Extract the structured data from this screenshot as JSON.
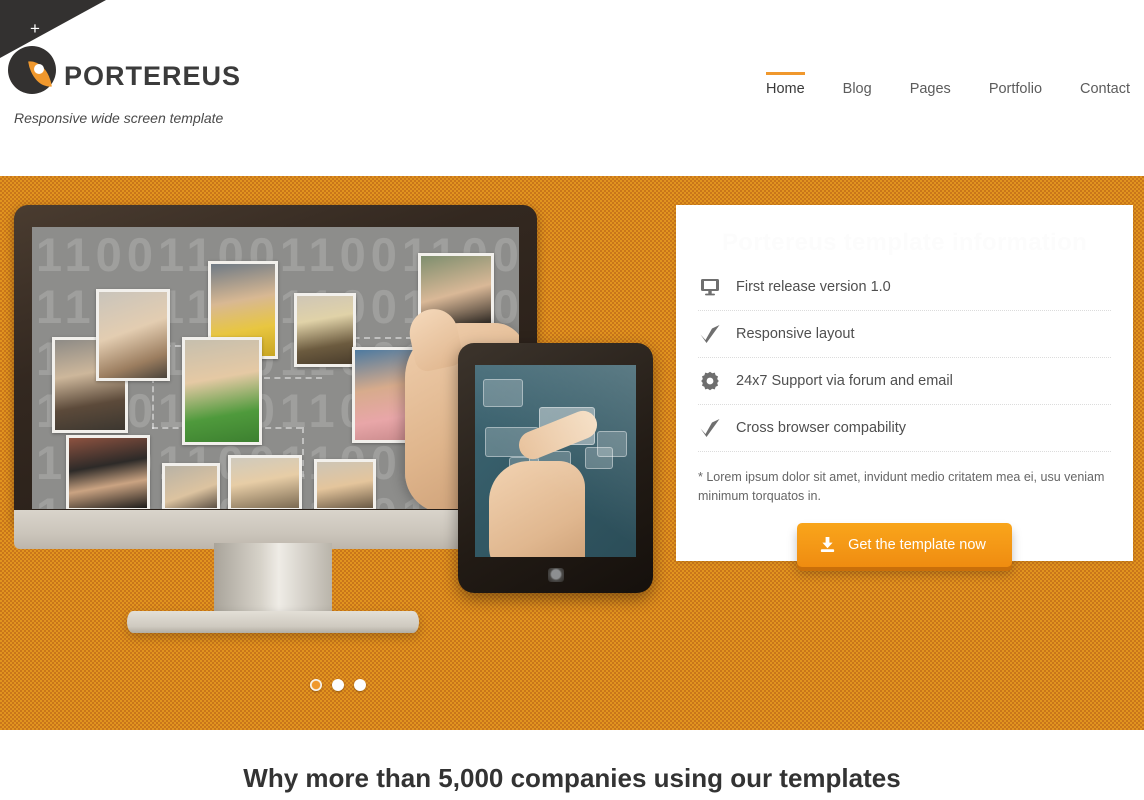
{
  "header": {
    "corner_plus_label": "+",
    "brand": "PORTEREUS",
    "tagline": "Responsive wide screen template",
    "nav": [
      {
        "label": "Home",
        "active": true
      },
      {
        "label": "Blog",
        "active": false
      },
      {
        "label": "Pages",
        "active": false
      },
      {
        "label": "Portfolio",
        "active": false
      },
      {
        "label": "Contact",
        "active": false
      }
    ]
  },
  "hero": {
    "panel": {
      "title": "Portereus template information",
      "features": [
        {
          "icon": "monitor-icon",
          "label": "First release version 1.0"
        },
        {
          "icon": "check-icon",
          "label": "Responsive layout"
        },
        {
          "icon": "gear-icon",
          "label": "24x7 Support via forum and email"
        },
        {
          "icon": "check-icon",
          "label": "Cross browser compability"
        }
      ],
      "note": "* Lorem ipsum dolor sit amet, invidunt medio critatem mea ei, usu veniam minimum torquatos in.",
      "cta_label": "Get the template now",
      "cta_icon": "download-icon"
    },
    "slider": {
      "dots": [
        {
          "active": true
        },
        {
          "active": false
        },
        {
          "active": false
        }
      ]
    },
    "screen_binary_text": "1100110011001100110011001100",
    "background_color": "#e1941f"
  },
  "bottom": {
    "heading": "Why more than 5,000 companies using our templates"
  },
  "colors": {
    "accent": "#f0982d",
    "dark": "#333130",
    "hero_bg": "#e1941f",
    "text": "#4f4f4f"
  }
}
